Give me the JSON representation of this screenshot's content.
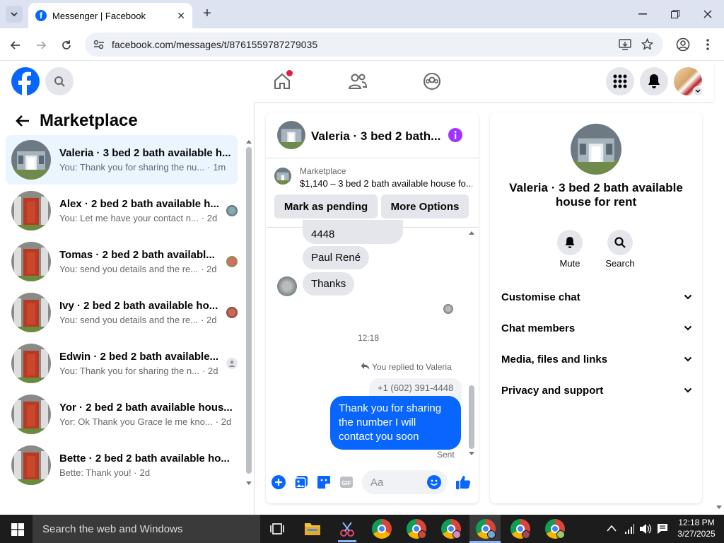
{
  "browser": {
    "tab_title": "Messenger | Facebook",
    "url": "facebook.com/messages/t/8761559787279035"
  },
  "left_panel": {
    "title": "Marketplace",
    "conversations": [
      {
        "name": "Valeria · 3 bed 2 bath available h...",
        "preview": "You: Thank you for sharing the nu...",
        "time": "· 1m",
        "active": true
      },
      {
        "name": "Alex · 2 bed 2 bath available h...",
        "preview": "You: Let me have your contact n...",
        "time": "· 2d",
        "active": false
      },
      {
        "name": "Tomas · 2 bed 2 bath availabl...",
        "preview": "You: send you details and the re...",
        "time": "· 2d",
        "active": false
      },
      {
        "name": "Ivy · 2 bed 2 bath available ho...",
        "preview": "You: send you details and the re...",
        "time": "· 2d",
        "active": false
      },
      {
        "name": "Edwin · 2 bed 2 bath available...",
        "preview": "You: Thank you for sharing the n...",
        "time": "· 2d",
        "active": false
      },
      {
        "name": "Yor · 2 bed 2 bath available hous...",
        "preview": "Yor: Ok Thank you Grace le me kno...",
        "time": "· 2d",
        "active": false
      },
      {
        "name": "Bette · 2 bed 2 bath available ho...",
        "preview": "Bette: Thank you! ·",
        "time": "2d",
        "active": false
      }
    ]
  },
  "chat": {
    "header_title": "Valeria · 3 bed 2 bath...",
    "marketplace_label": "Marketplace",
    "listing": "$1,140 – 3 bed 2 bath available house fo...",
    "mark_pending": "Mark as pending",
    "more_options": "More Options",
    "messages": {
      "m1": "4448",
      "m2": "Paul René",
      "m3": "Thanks",
      "time": "12:18",
      "replied": "You replied to Valeria",
      "quoted": "+1 (602) 391-4448",
      "out": "Thank you for sharing the number I will contact you soon",
      "status": "Sent"
    },
    "input_placeholder": "Aa"
  },
  "info": {
    "title": "Valeria · 3 bed 2 bath available house for rent",
    "mute": "Mute",
    "search": "Search",
    "sections": [
      "Customise chat",
      "Chat members",
      "Media, files and links",
      "Privacy and support"
    ]
  },
  "taskbar": {
    "search_placeholder": "Search the web and Windows",
    "time": "12:18 PM",
    "date": "3/27/2025"
  },
  "colors": {
    "brand": "#0866ff",
    "notification": "#e41e3f",
    "accent_purple": "#a033ff"
  }
}
